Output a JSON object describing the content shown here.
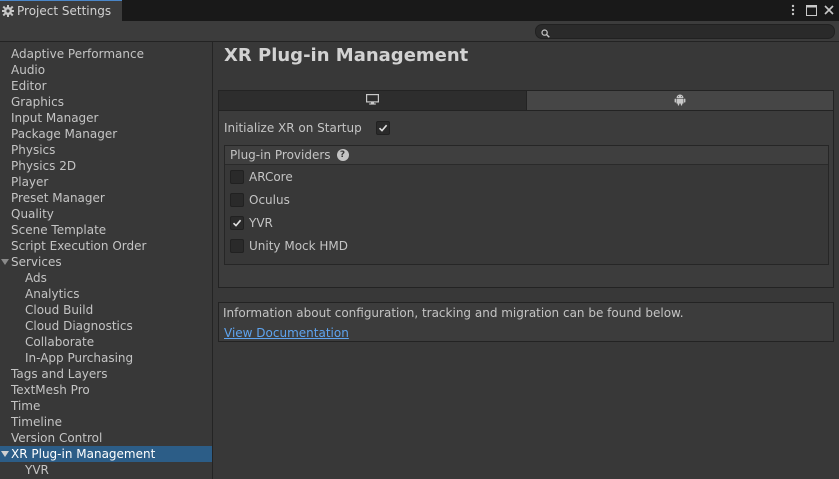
{
  "window": {
    "title": "Project Settings",
    "icon": "gear-icon",
    "controls": [
      "kebab-menu-icon",
      "maximize-icon",
      "close-icon"
    ]
  },
  "search": {
    "placeholder": "",
    "value": ""
  },
  "sidebar": {
    "items": [
      {
        "label": "Adaptive Performance",
        "level": 0
      },
      {
        "label": "Audio",
        "level": 0
      },
      {
        "label": "Editor",
        "level": 0
      },
      {
        "label": "Graphics",
        "level": 0
      },
      {
        "label": "Input Manager",
        "level": 0
      },
      {
        "label": "Package Manager",
        "level": 0
      },
      {
        "label": "Physics",
        "level": 0
      },
      {
        "label": "Physics 2D",
        "level": 0
      },
      {
        "label": "Player",
        "level": 0
      },
      {
        "label": "Preset Manager",
        "level": 0
      },
      {
        "label": "Quality",
        "level": 0
      },
      {
        "label": "Scene Template",
        "level": 0
      },
      {
        "label": "Script Execution Order",
        "level": 0
      },
      {
        "label": "Services",
        "level": 0,
        "expanded": true
      },
      {
        "label": "Ads",
        "level": 1
      },
      {
        "label": "Analytics",
        "level": 1
      },
      {
        "label": "Cloud Build",
        "level": 1
      },
      {
        "label": "Cloud Diagnostics",
        "level": 1
      },
      {
        "label": "Collaborate",
        "level": 1
      },
      {
        "label": "In-App Purchasing",
        "level": 1
      },
      {
        "label": "Tags and Layers",
        "level": 0
      },
      {
        "label": "TextMesh Pro",
        "level": 0
      },
      {
        "label": "Time",
        "level": 0
      },
      {
        "label": "Timeline",
        "level": 0
      },
      {
        "label": "Version Control",
        "level": 0
      },
      {
        "label": "XR Plug-in Management",
        "level": 0,
        "expanded": true,
        "selected": true
      },
      {
        "label": "YVR",
        "level": 1
      }
    ]
  },
  "main": {
    "title": "XR Plug-in Management",
    "platform_tabs": [
      {
        "icon": "desktop-monitor-icon",
        "active": false
      },
      {
        "icon": "android-icon",
        "active": true
      }
    ],
    "init_xr_label": "Initialize XR on Startup",
    "init_xr_checked": true,
    "providers_header": "Plug-in Providers",
    "providers": [
      {
        "label": "ARCore",
        "checked": false
      },
      {
        "label": "Oculus",
        "checked": false
      },
      {
        "label": "YVR",
        "checked": true
      },
      {
        "label": "Unity Mock HMD",
        "checked": false
      }
    ],
    "info_text": "Information about configuration, tracking and migration can be found below.",
    "doc_link": "View Documentation"
  },
  "colors": {
    "selection": "#2c5d87",
    "link": "#5ea4ef",
    "background": "#383838"
  }
}
